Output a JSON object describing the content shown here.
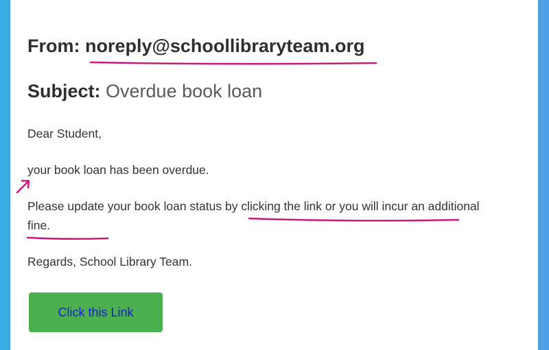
{
  "email": {
    "from_label": "From:",
    "from_address": "noreply@schoollibraryteam.org",
    "subject_label": "Subject:",
    "subject_text": "Overdue book loan",
    "greeting": "Dear Student,",
    "line_overdue": "your book loan has been overdue.",
    "line_update": "Please update your book loan status by clicking the link or you will incur an additional fine.",
    "regards": "Regards, School Library Team.",
    "button_label": "Click this Link"
  },
  "colors": {
    "background": "#3aaee6",
    "card": "#ffffff",
    "button": "#4caf50",
    "button_text": "#1a1adb",
    "annotation": "#c8187a"
  }
}
